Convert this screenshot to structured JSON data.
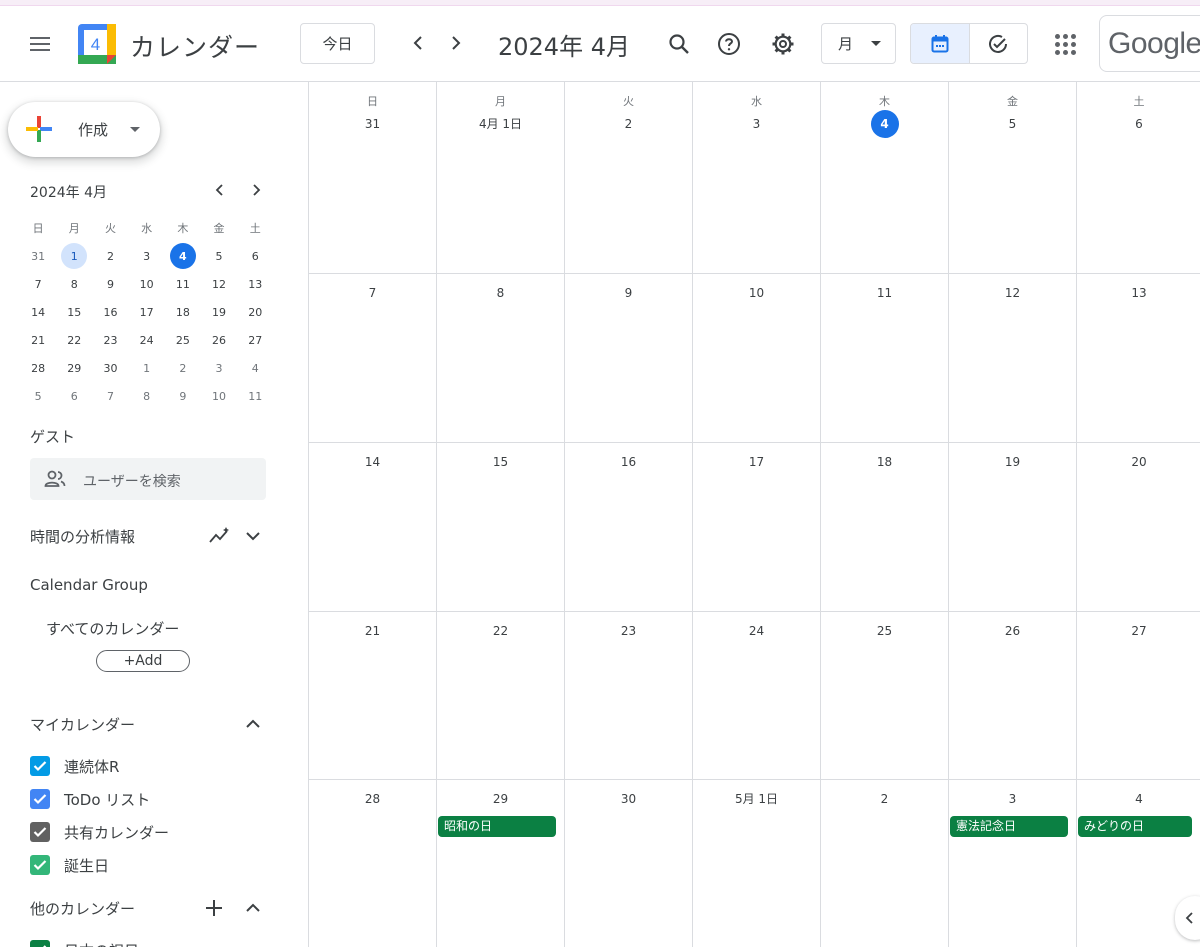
{
  "header": {
    "app_title": "カレンダー",
    "logo_day": "4",
    "today_label": "今日",
    "period_title": "2024年 4月",
    "view_label": "月",
    "brand": "Google"
  },
  "sidebar": {
    "create_label": "作成",
    "mini_calendar": {
      "title": "2024年 4月",
      "weekdays": [
        "日",
        "月",
        "火",
        "水",
        "木",
        "金",
        "土"
      ],
      "weeks": [
        [
          "31",
          "1",
          "2",
          "3",
          "4",
          "5",
          "6"
        ],
        [
          "7",
          "8",
          "9",
          "10",
          "11",
          "12",
          "13"
        ],
        [
          "14",
          "15",
          "16",
          "17",
          "18",
          "19",
          "20"
        ],
        [
          "21",
          "22",
          "23",
          "24",
          "25",
          "26",
          "27"
        ],
        [
          "28",
          "29",
          "30",
          "1",
          "2",
          "3",
          "4"
        ],
        [
          "5",
          "6",
          "7",
          "8",
          "9",
          "10",
          "11"
        ]
      ]
    },
    "guest_label": "ゲスト",
    "search_placeholder": "ユーザーを検索",
    "time_insights_label": "時間の分析情報",
    "calendar_group": {
      "title": "Calendar Group",
      "all_calendars": "すべてのカレンダー",
      "add_label": "+Add"
    },
    "my_calendars": {
      "title": "マイカレンダー",
      "items": [
        {
          "label": "連続体R",
          "color": "#039be5"
        },
        {
          "label": "ToDo リスト",
          "color": "#4285f4"
        },
        {
          "label": "共有カレンダー",
          "color": "#616161"
        },
        {
          "label": "誕生日",
          "color": "#33b679"
        }
      ]
    },
    "other_calendars": {
      "title": "他のカレンダー",
      "items": [
        {
          "label": "日本の祝日",
          "color": "#0b8043"
        }
      ]
    }
  },
  "month_grid": {
    "weekdays": [
      "日",
      "月",
      "火",
      "水",
      "木",
      "金",
      "土"
    ],
    "weeks": [
      [
        "31",
        "4月 1日",
        "2",
        "3",
        "4",
        "5",
        "6"
      ],
      [
        "7",
        "8",
        "9",
        "10",
        "11",
        "12",
        "13"
      ],
      [
        "14",
        "15",
        "16",
        "17",
        "18",
        "19",
        "20"
      ],
      [
        "21",
        "22",
        "23",
        "24",
        "25",
        "26",
        "27"
      ],
      [
        "28",
        "29",
        "30",
        "5月 1日",
        "2",
        "3",
        "4"
      ]
    ],
    "events": [
      {
        "title": "昭和の日",
        "color": "#0b8043"
      },
      {
        "title": "憲法記念日",
        "color": "#0b8043"
      },
      {
        "title": "みどりの日",
        "color": "#0b8043"
      }
    ]
  },
  "colors": {
    "accent": "#1a73e8",
    "selected_bg": "#e8f0fe",
    "holiday": "#0b8043"
  }
}
